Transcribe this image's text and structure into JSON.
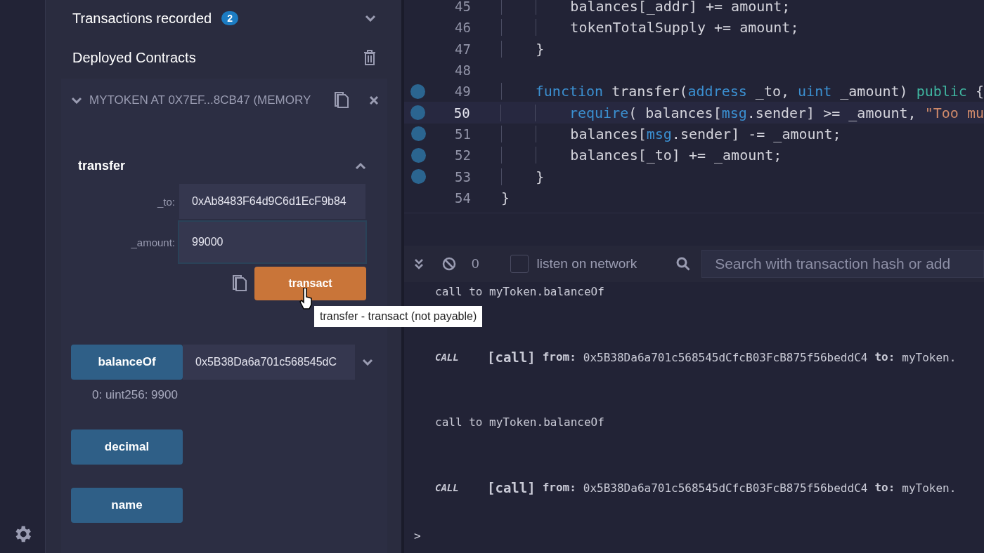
{
  "sidebar": {
    "transactions": {
      "label": "Transactions recorded",
      "count": "2",
      "expanded": false
    },
    "deployed": {
      "title": "Deployed Contracts"
    },
    "contract": {
      "title": "MYTOKEN AT 0X7EF...8CB47 (MEMORY",
      "expanded": true,
      "function": {
        "name": "transfer",
        "expanded": true,
        "params": [
          {
            "label": "_to:",
            "value": "0xAb8483F64d9C6d1EcF9b84",
            "focused": false
          },
          {
            "label": "_amount:",
            "value": "99000",
            "focused": true
          }
        ],
        "action": "transact",
        "tooltip": "transfer - transact (not payable)"
      },
      "calls": [
        {
          "name": "balanceOf",
          "value": "0x5B38Da6a701c568545dC",
          "result": "0: uint256: 9900"
        },
        {
          "name": "decimal"
        },
        {
          "name": "name"
        }
      ]
    }
  },
  "editor": {
    "lines": [
      {
        "number": "45",
        "breakpoint": false,
        "current": false,
        "tokens": [
          {
            "kind": "plain",
            "text": "        balances[_addr] += amount;"
          }
        ]
      },
      {
        "number": "46",
        "breakpoint": false,
        "current": false,
        "tokens": [
          {
            "kind": "plain",
            "text": "        tokenTotalSupply += amount;"
          }
        ]
      },
      {
        "number": "47",
        "breakpoint": false,
        "current": false,
        "tokens": [
          {
            "kind": "plain",
            "text": "    }"
          }
        ]
      },
      {
        "number": "48",
        "breakpoint": false,
        "current": false
      },
      {
        "number": "49",
        "breakpoint": true,
        "current": false,
        "tokens": [
          {
            "kind": "keyword",
            "text": "    function"
          },
          {
            "kind": "plain",
            "text": " transfer("
          },
          {
            "kind": "keyword",
            "text": "address"
          },
          {
            "kind": "plain",
            "text": " _to, "
          },
          {
            "kind": "keyword",
            "text": "uint"
          },
          {
            "kind": "plain",
            "text": " _amount) "
          },
          {
            "kind": "modifier",
            "text": "public"
          },
          {
            "kind": "plain",
            "text": " {"
          }
        ]
      },
      {
        "number": "50",
        "breakpoint": true,
        "current": true,
        "tokens": [
          {
            "kind": "keyword",
            "text": "        require"
          },
          {
            "kind": "plain",
            "text": "( balances["
          },
          {
            "kind": "keyword",
            "text": "msg"
          },
          {
            "kind": "plain",
            "text": ".sender] >= _amount, "
          },
          {
            "kind": "string",
            "text": "\"Too mu"
          }
        ]
      },
      {
        "number": "51",
        "breakpoint": true,
        "current": false,
        "tokens": [
          {
            "kind": "plain",
            "text": "        balances["
          },
          {
            "kind": "keyword",
            "text": "msg"
          },
          {
            "kind": "plain",
            "text": ".sender] -= _amount;"
          }
        ]
      },
      {
        "number": "52",
        "breakpoint": true,
        "current": false,
        "tokens": [
          {
            "kind": "plain",
            "text": "        balances[_to] += _amount;"
          }
        ]
      },
      {
        "number": "53",
        "breakpoint": true,
        "current": false,
        "tokens": [
          {
            "kind": "plain",
            "text": "    }"
          }
        ]
      },
      {
        "number": "54",
        "breakpoint": false,
        "current": false,
        "tokens": [
          {
            "kind": "plain",
            "text": "}"
          }
        ]
      }
    ]
  },
  "terminal": {
    "count": "0",
    "listen": {
      "label": "listen on network",
      "checked": false
    },
    "search": {
      "placeholder": "Search with transaction hash or add"
    },
    "entries": [
      {
        "kind": "text",
        "text": "call to myToken.balanceOf"
      },
      {
        "kind": "call",
        "badge": "CALL",
        "tag": "[call]",
        "from_label": "from:",
        "from": "0x5B38Da6a701c568545dCfcB03FcB875f56beddC4",
        "to_label": "to:",
        "to": "myToken."
      },
      {
        "kind": "text",
        "text": "call to myToken.balanceOf"
      },
      {
        "kind": "call",
        "badge": "CALL",
        "tag": "[call]",
        "from_label": "from:",
        "from": "0x5B38Da6a701c568545dCfcB03FcB875f56beddC4",
        "to_label": "to:",
        "to": "myToken."
      }
    ],
    "prompt": ">"
  }
}
